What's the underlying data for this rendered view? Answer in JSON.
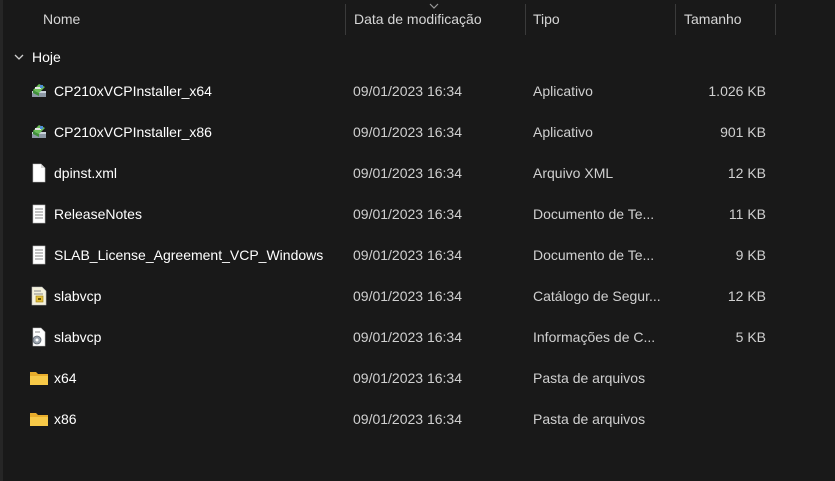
{
  "columns": {
    "name": "Nome",
    "date": "Data de modificação",
    "type": "Tipo",
    "size": "Tamanho"
  },
  "group": {
    "label": "Hoje"
  },
  "rows": [
    {
      "name": "CP210xVCPInstaller_x64",
      "date": "09/01/2023 16:34",
      "type": "Aplicativo",
      "size": "1.026 KB",
      "icon": "installer-icon"
    },
    {
      "name": "CP210xVCPInstaller_x86",
      "date": "09/01/2023 16:34",
      "type": "Aplicativo",
      "size": "901 KB",
      "icon": "installer-icon"
    },
    {
      "name": "dpinst.xml",
      "date": "09/01/2023 16:34",
      "type": "Arquivo XML",
      "size": "12 KB",
      "icon": "blank-file-icon"
    },
    {
      "name": "ReleaseNotes",
      "date": "09/01/2023 16:34",
      "type": "Documento de Te...",
      "size": "11 KB",
      "icon": "text-file-icon"
    },
    {
      "name": "SLAB_License_Agreement_VCP_Windows",
      "date": "09/01/2023 16:34",
      "type": "Documento de Te...",
      "size": "9 KB",
      "icon": "text-file-icon"
    },
    {
      "name": "slabvcp",
      "date": "09/01/2023 16:34",
      "type": "Catálogo de Segur...",
      "size": "12 KB",
      "icon": "security-catalog-icon"
    },
    {
      "name": "slabvcp",
      "date": "09/01/2023 16:34",
      "type": "Informações de C...",
      "size": "5 KB",
      "icon": "setup-info-icon"
    },
    {
      "name": "x64",
      "date": "09/01/2023 16:34",
      "type": "Pasta de arquivos",
      "size": "",
      "icon": "folder-icon"
    },
    {
      "name": "x86",
      "date": "09/01/2023 16:34",
      "type": "Pasta de arquivos",
      "size": "",
      "icon": "folder-icon"
    }
  ],
  "colors": {
    "background": "#191919",
    "text": "#ffffff",
    "secondary_text": "#d0d0d0",
    "folder": "#f3c34a"
  }
}
